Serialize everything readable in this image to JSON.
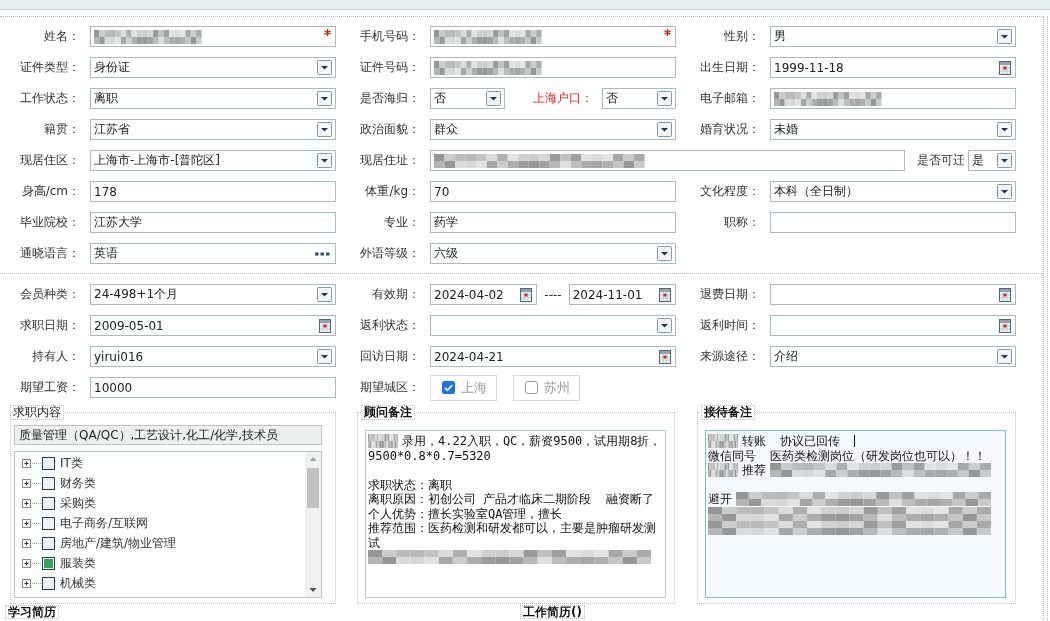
{
  "sections": [
    {
      "rows": [
        [
          {
            "label": "姓名：",
            "fields": [
              {
                "kind": "text",
                "blurred": true,
                "required": true
              }
            ]
          },
          {
            "label": "手机号码：",
            "fields": [
              {
                "kind": "text",
                "blurred": true,
                "required": true
              }
            ]
          },
          {
            "label": "性别：",
            "fields": [
              {
                "kind": "select",
                "value": "男"
              }
            ]
          }
        ],
        [
          {
            "label": "证件类型：",
            "fields": [
              {
                "kind": "select",
                "value": "身份证"
              }
            ]
          },
          {
            "label": "证件号码：",
            "fields": [
              {
                "kind": "text",
                "blurred": true
              }
            ]
          },
          {
            "label": "出生日期：",
            "fields": [
              {
                "kind": "date",
                "value": "1999-11-18"
              }
            ]
          }
        ],
        [
          {
            "label": "工作状态：",
            "fields": [
              {
                "kind": "select",
                "value": "离职"
              }
            ]
          },
          {
            "label": "是否海归：",
            "fields": [
              {
                "kind": "select",
                "value": "否"
              },
              {
                "label": "上海户口：",
                "alert": true,
                "kind": "select",
                "value": "否"
              }
            ]
          },
          {
            "label": "电子邮箱：",
            "fields": [
              {
                "kind": "text",
                "blurred": true
              }
            ]
          }
        ],
        [
          {
            "label": "籍贯：",
            "fields": [
              {
                "kind": "select",
                "value": "江苏省"
              }
            ]
          },
          {
            "label": "政治面貌：",
            "fields": [
              {
                "kind": "select",
                "value": "群众"
              }
            ]
          },
          {
            "label": "婚育状况：",
            "fields": [
              {
                "kind": "select",
                "value": "未婚"
              }
            ]
          }
        ],
        [
          {
            "label": "现居住区：",
            "fields": [
              {
                "kind": "select",
                "value": "上海市-上海市-[普陀区]"
              }
            ]
          },
          {
            "label": "现居住址：",
            "wide": true,
            "fields": [
              {
                "kind": "text",
                "blurred": true
              },
              {
                "label": "是否可迁",
                "kind": "select",
                "value": "是"
              }
            ]
          }
        ],
        [
          {
            "label": "身高/cm：",
            "fields": [
              {
                "kind": "text",
                "value": "178"
              }
            ]
          },
          {
            "label": "体重/kg：",
            "fields": [
              {
                "kind": "text",
                "value": "70"
              }
            ]
          },
          {
            "label": "文化程度：",
            "fields": [
              {
                "kind": "select",
                "value": "本科（全日制）"
              }
            ]
          }
        ],
        [
          {
            "label": "毕业院校：",
            "fields": [
              {
                "kind": "text",
                "value": "江苏大学"
              }
            ]
          },
          {
            "label": "专业：",
            "fields": [
              {
                "kind": "text",
                "value": "药学"
              }
            ]
          },
          {
            "label": "职称：",
            "fields": [
              {
                "kind": "text"
              }
            ]
          }
        ],
        [
          {
            "label": "通晓语言：",
            "fields": [
              {
                "kind": "lookup",
                "value": "英语"
              }
            ]
          },
          {
            "label": "外语等级：",
            "fields": [
              {
                "kind": "select",
                "value": "六级"
              }
            ]
          }
        ]
      ]
    },
    {
      "rows": [
        [
          {
            "label": "会员种类：",
            "fields": [
              {
                "kind": "select",
                "value": "24-498+1个月"
              }
            ]
          },
          {
            "label": "有效期：",
            "fields": [
              {
                "kind": "date",
                "value": "2024-04-02"
              },
              {
                "label": "----",
                "kind": "date",
                "value": "2024-11-01"
              }
            ]
          },
          {
            "label": "退费日期：",
            "fields": [
              {
                "kind": "date"
              }
            ]
          }
        ],
        [
          {
            "label": "求职日期：",
            "fields": [
              {
                "kind": "date",
                "value": "2009-05-01"
              }
            ]
          },
          {
            "label": "返利状态：",
            "fields": [
              {
                "kind": "select"
              }
            ]
          },
          {
            "label": "返利时间：",
            "fields": [
              {
                "kind": "date"
              }
            ]
          }
        ],
        [
          {
            "label": "持有人：",
            "fields": [
              {
                "kind": "select",
                "value": "yirui016"
              }
            ]
          },
          {
            "label": "回访日期：",
            "fields": [
              {
                "kind": "date",
                "value": "2024-04-21"
              }
            ]
          },
          {
            "label": "来源途径：",
            "fields": [
              {
                "kind": "select",
                "value": "介绍"
              }
            ]
          }
        ],
        [
          {
            "label": "期望工资：",
            "fields": [
              {
                "kind": "text",
                "value": "10000"
              }
            ]
          },
          {
            "label": "期望城区：",
            "fields": [
              {
                "kind": "checks",
                "options": [
                  {
                    "label": "上海",
                    "checked": true
                  },
                  {
                    "label": "苏州",
                    "checked": false
                  }
                ]
              }
            ]
          }
        ]
      ]
    }
  ],
  "panels": [
    {
      "kind": "tree",
      "legend": "求职内容",
      "summary": "质量管理（QA/QC）,工艺设计,化工/化学,技术员",
      "items": [
        {
          "label": "IT类",
          "expanded": false,
          "checked": false,
          "partial": false
        },
        {
          "label": "财务类",
          "expanded": false,
          "checked": false,
          "partial": false
        },
        {
          "label": "采购类",
          "expanded": false,
          "checked": false,
          "partial": false
        },
        {
          "label": "电子商务/互联网",
          "expanded": false,
          "checked": false,
          "partial": false
        },
        {
          "label": "房地产/建筑/物业管理",
          "expanded": false,
          "checked": false,
          "partial": false
        },
        {
          "label": "服装类",
          "expanded": false,
          "checked": false,
          "partial": true
        },
        {
          "label": "机械类",
          "expanded": false,
          "checked": false,
          "partial": false
        }
      ]
    },
    {
      "kind": "notes",
      "legend": "顾问备注",
      "focused": false,
      "paragraphs": [
        {
          "lines": [
            {
              "segments": [
                {
                  "kind": "blur"
                },
                {
                  "kind": "text",
                  "text": "录用，4.22入职，QC，薪资9500，试用期8折，"
                }
              ]
            },
            {
              "segments": [
                {
                  "kind": "text",
                  "text": "9500*0.8*0.7=5320"
                }
              ]
            }
          ]
        },
        {
          "lines": [
            {
              "segments": [
                {
                  "kind": "text",
                  "text": "求职状态：离职"
                }
              ]
            },
            {
              "segments": [
                {
                  "kind": "text",
                  "text": "离职原因：初创公司 产品才临床二期阶段  融资断了"
                }
              ]
            },
            {
              "segments": [
                {
                  "kind": "text",
                  "text": "个人优势：擅长实验室QA管理，擅长"
                }
              ]
            },
            {
              "segments": [
                {
                  "kind": "text",
                  "text": "推荐范围：医药检测和研发都可以，主要是肿瘤研发测"
                }
              ]
            },
            {
              "segments": [
                {
                  "kind": "text",
                  "text": "试"
                }
              ]
            },
            {
              "segments": [
                {
                  "kind": "blur"
                }
              ]
            }
          ]
        }
      ]
    },
    {
      "kind": "notes",
      "legend": "接待备注",
      "focused": true,
      "paragraphs": [
        {
          "lines": [
            {
              "segments": [
                {
                  "kind": "blur"
                },
                {
                  "kind": "text",
                  "text": "转账  协议已回传"
                }
              ],
              "caret": true
            },
            {
              "segments": [
                {
                  "kind": "text",
                  "text": "微信同号  医药类检测岗位（研发岗位也可以）！！"
                }
              ]
            },
            {
              "segments": [
                {
                  "kind": "blur"
                },
                {
                  "kind": "text",
                  "text": "推荐"
                },
                {
                  "kind": "blur"
                }
              ]
            }
          ]
        },
        {
          "lines": [
            {
              "segments": [
                {
                  "kind": "text",
                  "text": "避开"
                },
                {
                  "kind": "blur"
                }
              ]
            },
            {
              "segments": [
                {
                  "kind": "blur"
                }
              ]
            },
            {
              "segments": [
                {
                  "kind": "blur"
                }
              ]
            }
          ]
        }
      ]
    }
  ],
  "next_sections": [
    {
      "legend": "学习简历"
    },
    {
      "legend": "工作简历()"
    }
  ]
}
